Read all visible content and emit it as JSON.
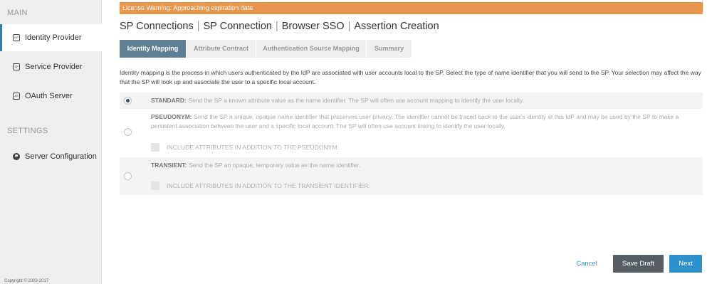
{
  "sidebar": {
    "main_label": "MAIN",
    "settings_label": "SETTINGS",
    "items": [
      {
        "label": "Identity Provider",
        "icon": "IdP",
        "active": true
      },
      {
        "label": "Service Provider",
        "icon": "SP",
        "active": false
      },
      {
        "label": "OAuth Server",
        "icon": "AS",
        "active": false
      }
    ],
    "settings_items": [
      {
        "label": "Server Configuration",
        "icon": "server-icon"
      }
    ],
    "copyright": "Copyright © 2003-2017"
  },
  "warning": "License Warning: Approaching expiration date",
  "breadcrumb": [
    "SP Connections",
    "SP Connection",
    "Browser SSO",
    "Assertion Creation"
  ],
  "tabs": [
    {
      "label": "Identity Mapping",
      "active": true
    },
    {
      "label": "Attribute Contract",
      "active": false
    },
    {
      "label": "Authentication Source Mapping",
      "active": false
    },
    {
      "label": "Summary",
      "active": false
    }
  ],
  "description": "Identity mapping is the process in which users authenticated by the IdP are associated with user accounts local to the SP. Select the type of name identifier that you will send to the SP. Your selection may affect the way that the SP will look up and associate the user to a specific local account.",
  "options": {
    "standard": {
      "title": "STANDARD:",
      "text": "Send the SP a known attribute value as the name identifier. The SP will often use account mapping to identify the user locally.",
      "checked": true
    },
    "pseudonym": {
      "title": "PSEUDONYM:",
      "text": "Send the SP a unique, opaque name identifier that preserves user privacy. The identifier cannot be traced back to the user's identity at this IdP and may be used by the SP to make a persistent association between the user and a specific local account. The SP will often use account linking to identify the user locally.",
      "checked": false,
      "checkbox_label": "INCLUDE ATTRIBUTES IN ADDITION TO THE PSEUDONYM."
    },
    "transient": {
      "title": "TRANSIENT:",
      "text": "Send the SP an opaque, temporary value as the name identifier.",
      "checked": false,
      "checkbox_label": "INCLUDE ATTRIBUTES IN ADDITION TO THE TRANSIENT IDENTIFIER."
    }
  },
  "buttons": {
    "cancel": "Cancel",
    "save_draft": "Save Draft",
    "next": "Next"
  },
  "colors": {
    "warning": "#e8964d",
    "active_tab": "#5f7f93",
    "next_button": "#2e90cc",
    "draft_button": "#555f63",
    "active_nav_border": "#3a7ca8"
  }
}
